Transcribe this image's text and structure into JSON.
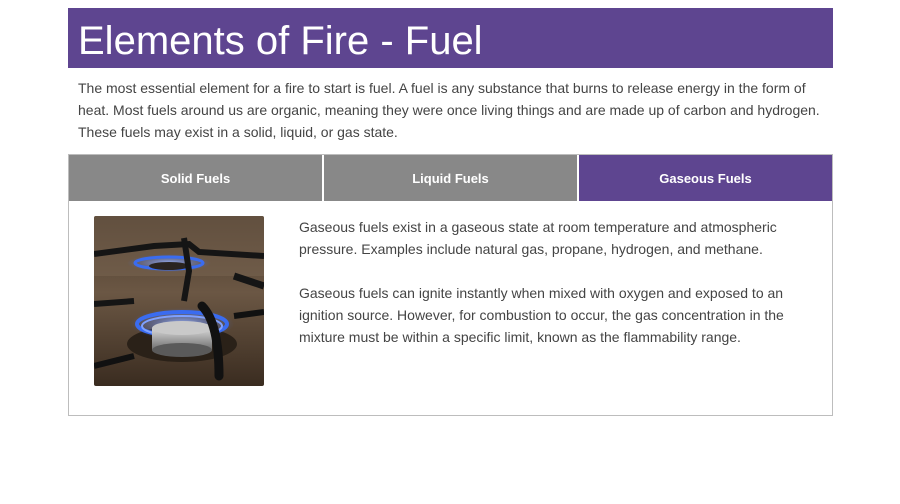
{
  "header": {
    "title": "Elements of Fire - Fuel"
  },
  "intro": {
    "text": "The most essential element for a fire to start is fuel. A fuel is any substance that burns to release energy in the form of heat. Most fuels around us are organic, meaning they were once living things and are made up of carbon and hydrogen. These fuels may exist in a solid, liquid, or gas state."
  },
  "tabs": [
    {
      "label": "Solid Fuels",
      "active": false
    },
    {
      "label": "Liquid Fuels",
      "active": false
    },
    {
      "label": "Gaseous Fuels",
      "active": true
    }
  ],
  "panel": {
    "image_subject": "gas-stove-burner-flame",
    "paragraphs": [
      "Gaseous fuels exist in a gaseous state at room temperature and atmospheric pressure. Examples include natural gas, propane, hydrogen, and methane.",
      "Gaseous fuels can ignite instantly when mixed with oxygen and exposed to an ignition source. However, for combustion to occur, the gas concentration in the mixture must be within a specific limit, known as the flammability range."
    ]
  },
  "colors": {
    "accent": "#5e4590",
    "tab_inactive": "#888888",
    "text": "#444444",
    "flame": "#3a6cf0"
  }
}
